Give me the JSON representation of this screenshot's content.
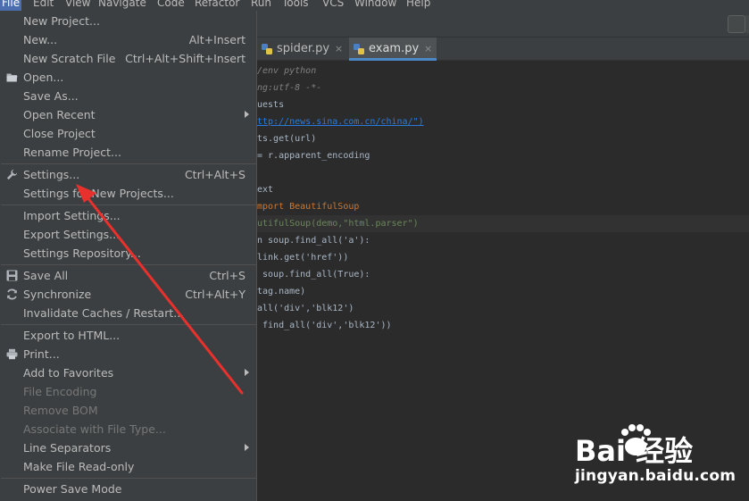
{
  "menubar": {
    "items": [
      "File",
      "Edit",
      "View",
      "Navigate",
      "Code",
      "Refactor",
      "Run",
      "Tools",
      "VCS",
      "Window",
      "Help"
    ],
    "active_index": 0
  },
  "tabs": [
    {
      "label": "spider.py",
      "close": "×",
      "active": false
    },
    {
      "label": "exam.py",
      "close": "×",
      "active": true
    }
  ],
  "editor": {
    "lines": [
      "/env python",
      "ng:utf-8 -*-",
      "uests",
      "ttp://news.sina.com.cn/china/\")",
      "ts.get(url)",
      "= r.apparent_encoding",
      "",
      "ext",
      "mport BeautifulSoup",
      "utifulSoup(demo,\"html.parser\")",
      "n soup.find_all('a'):",
      "link.get('href'))",
      " soup.find_all(True):",
      "tag.name)",
      "all('div','blk12')",
      " find_all('div','blk12'))"
    ]
  },
  "file_menu": {
    "items": [
      {
        "label": "New Project...",
        "shortcut": "",
        "submenu": false,
        "disabled": false,
        "icon": ""
      },
      {
        "label": "New...",
        "shortcut": "Alt+Insert",
        "submenu": false,
        "disabled": false,
        "icon": ""
      },
      {
        "label": "New Scratch File",
        "shortcut": "Ctrl+Alt+Shift+Insert",
        "submenu": false,
        "disabled": false,
        "icon": ""
      },
      {
        "label": "Open...",
        "shortcut": "",
        "submenu": false,
        "disabled": false,
        "icon": "folder-icon"
      },
      {
        "label": "Save As...",
        "shortcut": "",
        "submenu": false,
        "disabled": false,
        "icon": ""
      },
      {
        "label": "Open Recent",
        "shortcut": "",
        "submenu": true,
        "disabled": false,
        "icon": ""
      },
      {
        "label": "Close Project",
        "shortcut": "",
        "submenu": false,
        "disabled": false,
        "icon": ""
      },
      {
        "label": "Rename Project...",
        "shortcut": "",
        "submenu": false,
        "disabled": false,
        "icon": ""
      },
      {
        "label": "Settings...",
        "shortcut": "Ctrl+Alt+S",
        "submenu": false,
        "disabled": false,
        "icon": "wrench-icon"
      },
      {
        "label": "Settings for New Projects...",
        "shortcut": "",
        "submenu": false,
        "disabled": false,
        "icon": ""
      },
      {
        "label": "Import Settings...",
        "shortcut": "",
        "submenu": false,
        "disabled": false,
        "icon": ""
      },
      {
        "label": "Export Settings...",
        "shortcut": "",
        "submenu": false,
        "disabled": false,
        "icon": ""
      },
      {
        "label": "Settings Repository...",
        "shortcut": "",
        "submenu": false,
        "disabled": false,
        "icon": ""
      },
      {
        "label": "Save All",
        "shortcut": "Ctrl+S",
        "submenu": false,
        "disabled": false,
        "icon": "save-icon"
      },
      {
        "label": "Synchronize",
        "shortcut": "Ctrl+Alt+Y",
        "submenu": false,
        "disabled": false,
        "icon": "sync-icon"
      },
      {
        "label": "Invalidate Caches / Restart...",
        "shortcut": "",
        "submenu": false,
        "disabled": false,
        "icon": ""
      },
      {
        "label": "Export to HTML...",
        "shortcut": "",
        "submenu": false,
        "disabled": false,
        "icon": ""
      },
      {
        "label": "Print...",
        "shortcut": "",
        "submenu": false,
        "disabled": false,
        "icon": "printer-icon"
      },
      {
        "label": "Add to Favorites",
        "shortcut": "",
        "submenu": true,
        "disabled": false,
        "icon": ""
      },
      {
        "label": "File Encoding",
        "shortcut": "",
        "submenu": false,
        "disabled": true,
        "icon": ""
      },
      {
        "label": "Remove BOM",
        "shortcut": "",
        "submenu": false,
        "disabled": true,
        "icon": ""
      },
      {
        "label": "Associate with File Type...",
        "shortcut": "",
        "submenu": false,
        "disabled": true,
        "icon": ""
      },
      {
        "label": "Line Separators",
        "shortcut": "",
        "submenu": true,
        "disabled": false,
        "icon": ""
      },
      {
        "label": "Make File Read-only",
        "shortcut": "",
        "submenu": false,
        "disabled": false,
        "icon": ""
      },
      {
        "label": "Power Save Mode",
        "shortcut": "",
        "submenu": false,
        "disabled": false,
        "icon": ""
      }
    ]
  },
  "watermark": {
    "brand": "Bai 经验",
    "url": "jingyan.baidu.com"
  },
  "colors": {
    "menu_bg": "#3c3f41",
    "editor_bg": "#2b2b2b",
    "accent": "#4b6eaf",
    "arrow": "#e8312c"
  }
}
